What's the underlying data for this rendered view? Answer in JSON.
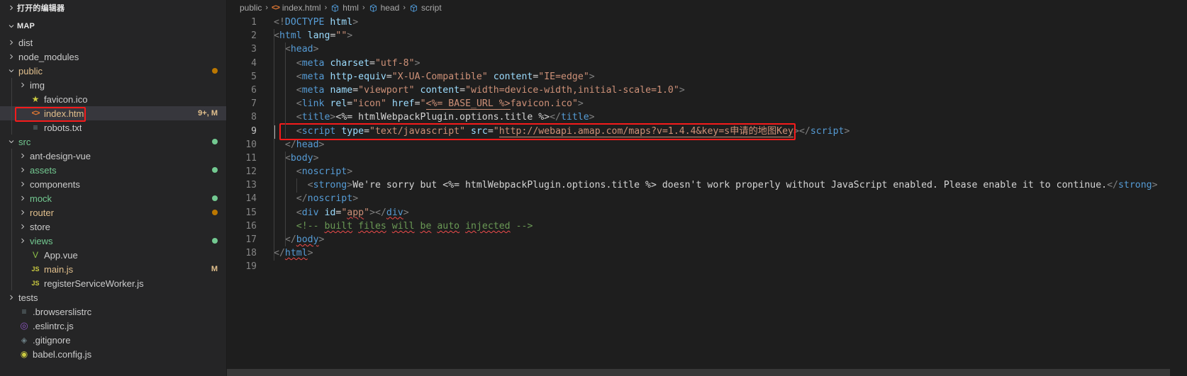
{
  "sidebar": {
    "open_editors_label": "打开的编辑器",
    "workspace_label": "MAP",
    "tree": [
      {
        "label": "dist",
        "type": "folder",
        "depth": 1,
        "expanded": false,
        "color": "#cccccc",
        "deco": "",
        "decoColor": ""
      },
      {
        "label": "node_modules",
        "type": "folder",
        "depth": 1,
        "expanded": false,
        "color": "#cccccc",
        "deco": "",
        "decoColor": ""
      },
      {
        "label": "public",
        "type": "folder",
        "depth": 1,
        "expanded": true,
        "color": "#e2c08d",
        "deco": "dot",
        "decoColor": "#bb7700"
      },
      {
        "label": "img",
        "type": "folder",
        "depth": 2,
        "expanded": false,
        "color": "#cccccc",
        "deco": "",
        "decoColor": ""
      },
      {
        "label": "favicon.ico",
        "type": "star",
        "depth": 2,
        "expanded": null,
        "color": "#cccccc",
        "deco": "",
        "decoColor": ""
      },
      {
        "label": "index.html",
        "type": "html",
        "depth": 2,
        "expanded": null,
        "color": "#e2c08d",
        "deco": "9+, M",
        "decoColor": "#e2c08d",
        "selected": true,
        "highlight": true
      },
      {
        "label": "robots.txt",
        "type": "lines",
        "depth": 2,
        "expanded": null,
        "color": "#cccccc",
        "deco": "",
        "decoColor": ""
      },
      {
        "label": "src",
        "type": "folder",
        "depth": 1,
        "expanded": true,
        "color": "#73c991",
        "deco": "dot",
        "decoColor": "#73c991"
      },
      {
        "label": "ant-design-vue",
        "type": "folder",
        "depth": 2,
        "expanded": false,
        "color": "#cccccc",
        "deco": "",
        "decoColor": ""
      },
      {
        "label": "assets",
        "type": "folder",
        "depth": 2,
        "expanded": false,
        "color": "#73c991",
        "deco": "dot",
        "decoColor": "#73c991"
      },
      {
        "label": "components",
        "type": "folder",
        "depth": 2,
        "expanded": false,
        "color": "#cccccc",
        "deco": "",
        "decoColor": ""
      },
      {
        "label": "mock",
        "type": "folder",
        "depth": 2,
        "expanded": false,
        "color": "#73c991",
        "deco": "dot",
        "decoColor": "#73c991"
      },
      {
        "label": "router",
        "type": "folder",
        "depth": 2,
        "expanded": false,
        "color": "#e2c08d",
        "deco": "dot",
        "decoColor": "#bb7700"
      },
      {
        "label": "store",
        "type": "folder",
        "depth": 2,
        "expanded": false,
        "color": "#cccccc",
        "deco": "",
        "decoColor": ""
      },
      {
        "label": "views",
        "type": "folder",
        "depth": 2,
        "expanded": false,
        "color": "#73c991",
        "deco": "dot",
        "decoColor": "#73c991"
      },
      {
        "label": "App.vue",
        "type": "vue",
        "depth": 2,
        "expanded": null,
        "color": "#cccccc",
        "deco": "",
        "decoColor": ""
      },
      {
        "label": "main.js",
        "type": "js",
        "depth": 2,
        "expanded": null,
        "color": "#e2c08d",
        "deco": "M",
        "decoColor": "#e2c08d"
      },
      {
        "label": "registerServiceWorker.js",
        "type": "js",
        "depth": 2,
        "expanded": null,
        "color": "#cccccc",
        "deco": "",
        "decoColor": ""
      },
      {
        "label": "tests",
        "type": "folder",
        "depth": 1,
        "expanded": false,
        "color": "#cccccc",
        "deco": "",
        "decoColor": ""
      },
      {
        "label": ".browserslistrc",
        "type": "lines",
        "depth": 1,
        "expanded": null,
        "color": "#cccccc",
        "deco": "",
        "decoColor": ""
      },
      {
        "label": ".eslintrc.js",
        "type": "eslint",
        "depth": 1,
        "expanded": null,
        "color": "#cccccc",
        "deco": "",
        "decoColor": ""
      },
      {
        "label": ".gitignore",
        "type": "git",
        "depth": 1,
        "expanded": null,
        "color": "#cccccc",
        "deco": "",
        "decoColor": ""
      },
      {
        "label": "babel.config.js",
        "type": "json",
        "depth": 1,
        "expanded": null,
        "color": "#cccccc",
        "deco": "",
        "decoColor": ""
      }
    ]
  },
  "breadcrumbs": [
    {
      "label": "public",
      "icon": ""
    },
    {
      "label": "index.html",
      "icon": "html-icon"
    },
    {
      "label": "html",
      "icon": "symbol-field-icon"
    },
    {
      "label": "head",
      "icon": "symbol-field-icon"
    },
    {
      "label": "script",
      "icon": "symbol-field-icon"
    }
  ],
  "editor": {
    "highlighted_line": 9,
    "total_lines": 19,
    "lines": [
      {
        "n": "1",
        "indent": 0
      },
      {
        "n": "2",
        "indent": 0
      },
      {
        "n": "3",
        "indent": 1
      },
      {
        "n": "4",
        "indent": 2
      },
      {
        "n": "5",
        "indent": 2
      },
      {
        "n": "6",
        "indent": 2
      },
      {
        "n": "7",
        "indent": 2
      },
      {
        "n": "8",
        "indent": 2
      },
      {
        "n": "9",
        "indent": 2
      },
      {
        "n": "10",
        "indent": 1
      },
      {
        "n": "11",
        "indent": 1
      },
      {
        "n": "12",
        "indent": 2
      },
      {
        "n": "13",
        "indent": 3
      },
      {
        "n": "14",
        "indent": 2
      },
      {
        "n": "15",
        "indent": 2
      },
      {
        "n": "16",
        "indent": 2
      },
      {
        "n": "17",
        "indent": 1
      },
      {
        "n": "18",
        "indent": 0
      },
      {
        "n": "19",
        "indent": 0
      }
    ],
    "source_text": [
      "<!DOCTYPE html>",
      "<html lang=\"\">",
      "  <head>",
      "    <meta charset=\"utf-8\">",
      "    <meta http-equiv=\"X-UA-Compatible\" content=\"IE=edge\">",
      "    <meta name=\"viewport\" content=\"width=device-width,initial-scale=1.0\">",
      "    <link rel=\"icon\" href=\"<%= BASE_URL %>favicon.ico\">",
      "    <title><%= htmlWebpackPlugin.options.title %></title>",
      "    <script type=\"text/javascript\" src=\"http://webapi.amap.com/maps?v=1.4.4&key=s申请的地图Key></script>",
      "  </head>",
      "  <body>",
      "    <noscript>",
      "      <strong>We're sorry but <%= htmlWebpackPlugin.options.title %> doesn't work properly without JavaScript enabled. Please enable it to continue.</strong>",
      "    </noscript>",
      "    <div id=\"app\"></div>",
      "    <!-- built files will be auto injected -->",
      "  </body>",
      "</html>",
      ""
    ]
  },
  "colors": {
    "annotation_red": "#f51b1b",
    "editor_background": "#1e1e1e",
    "sidebar_background": "#252526",
    "selection_background": "#37373d",
    "modified_amber": "#e2c08d",
    "untracked_green": "#73c991"
  }
}
